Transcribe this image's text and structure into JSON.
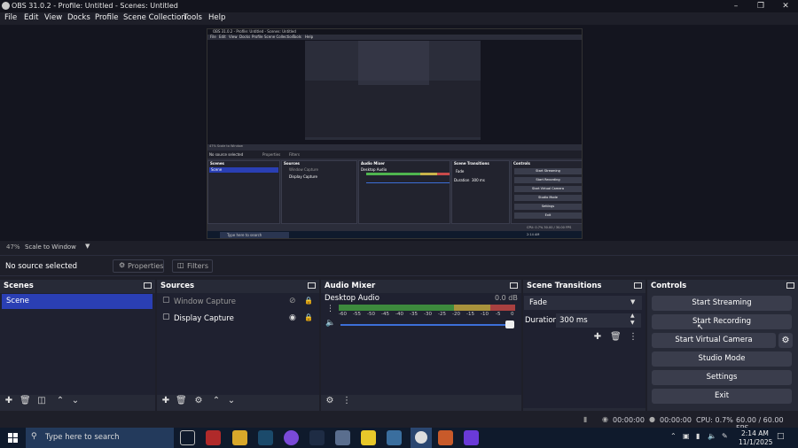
{
  "window": {
    "title": "OBS 31.0.2 - Profile: Untitled - Scenes: Untitled"
  },
  "menu": [
    "File",
    "Edit",
    "View",
    "Docks",
    "Profile",
    "Scene Collection",
    "Tools",
    "Help"
  ],
  "preview": {
    "zoom": "47%",
    "scale_mode": "Scale to Window",
    "mini_title": "OBS 31.0.2 - Profile: Untitled - Scenes: Untitled",
    "mini_menu": [
      "File",
      "Edit",
      "View",
      "Docks",
      "Profile",
      "Scene Collection",
      "Tools",
      "Help"
    ],
    "mini_no_source": "No source selected",
    "mini_properties": "Properties",
    "mini_filters": "Filters",
    "mini_docks": [
      "Scenes",
      "Sources",
      "Audio Mixer",
      "Scene Transitions",
      "Controls"
    ],
    "mini_scene": "Scene",
    "mini_sources": [
      "Window Capture",
      "Display Capture"
    ],
    "mini_audio": "Desktop Audio",
    "mini_transition": "Fade",
    "mini_duration_label": "Duration",
    "mini_duration": "300 ms",
    "mini_controls": [
      "Start Streaming",
      "Start Recording",
      "Start Virtual Camera",
      "Studio Mode",
      "Settings",
      "Exit"
    ],
    "mini_search": "Type here to search",
    "mini_status": "CPU: 0.7%   30.00 / 30.00 FPS"
  },
  "source_toolbar": {
    "no_source": "No source selected",
    "properties": "Properties",
    "filters": "Filters"
  },
  "scenes": {
    "title": "Scenes",
    "items": [
      "Scene"
    ]
  },
  "sources": {
    "title": "Sources",
    "items": [
      "Window Capture",
      "Display Capture"
    ]
  },
  "audio_mixer": {
    "title": "Audio Mixer",
    "channel": "Desktop Audio",
    "level": "0.0 dB",
    "ticks": [
      "-60",
      "-55",
      "-50",
      "-45",
      "-40",
      "-35",
      "-30",
      "-25",
      "-20",
      "-15",
      "-10",
      "-5",
      "0"
    ],
    "volume": 1.0
  },
  "transitions": {
    "title": "Scene Transitions",
    "type": "Fade",
    "duration_label": "Duration",
    "duration": "300 ms"
  },
  "controls": {
    "title": "Controls",
    "start_streaming": "Start Streaming",
    "start_recording": "Start Recording",
    "start_virtual_camera": "Start Virtual Camera",
    "studio_mode": "Studio Mode",
    "settings": "Settings",
    "exit": "Exit"
  },
  "status": {
    "stream_time": "00:00:00",
    "rec_time": "00:00:00",
    "cpu": "CPU: 0.7%",
    "fps": "60.00 / 60.00 FPS"
  },
  "taskbar": {
    "search_placeholder": "Type here to search",
    "time": "2:14 AM",
    "date": "11/1/2025"
  },
  "colors": {
    "accent": "#2a3fb4",
    "dock_bg": "#272a37",
    "meter_green": "#4fb54f",
    "meter_yellow": "#c9b34a",
    "meter_red": "#c94a4a"
  }
}
